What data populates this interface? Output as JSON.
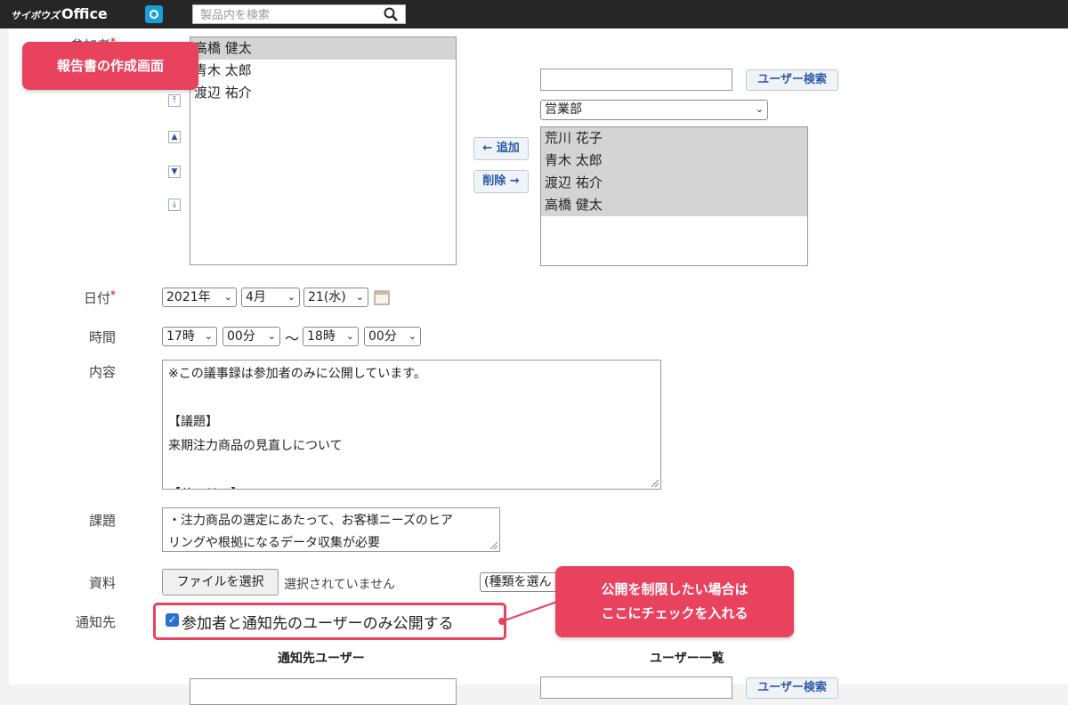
{
  "app": {
    "logo_small": "サイボウズ",
    "logo_big": "Office"
  },
  "search": {
    "placeholder": "製品内を検索"
  },
  "callouts": {
    "screen_title": "報告書の作成画面",
    "publish_line1": "公開を制限したい場合は",
    "publish_line2": "ここにチェックを入れる"
  },
  "participants": {
    "label": "参加者",
    "selected": [
      "高橋 健太",
      "青木 太郎",
      "渡辺 祐介"
    ],
    "add_label": "← 追加",
    "remove_label": "削除 →",
    "user_search_label": "ユーザー検索",
    "user_search_value": "",
    "group_select": "営業部",
    "candidates": [
      "荒川 花子",
      "青木 太郎",
      "渡辺 祐介",
      "高橋 健太"
    ]
  },
  "date": {
    "label": "日付",
    "year": "2021年",
    "month": "4月",
    "day": "21(水)"
  },
  "time": {
    "label": "時間",
    "start_hour": "17時",
    "start_min": "00分",
    "separator": "〜",
    "end_hour": "18時",
    "end_min": "00分"
  },
  "content": {
    "label": "内容",
    "lines": [
      "※この議事録は参加者のみに公開しています。",
      "",
      "【議題】",
      "来期注力商品の見直しについて",
      "",
      "【サマリー】"
    ]
  },
  "issues": {
    "label": "課題",
    "lines": [
      "・注力商品の選定にあたって、お客様ニーズのヒア",
      "リングや根拠になるデータ収集が必要"
    ]
  },
  "attachments": {
    "label": "資料",
    "file_button": "ファイルを選択",
    "no_file": "選択されていません",
    "type_select": "(種類を選ん"
  },
  "notify": {
    "label": "通知先",
    "checkbox_label": "参加者と通知先のユーザーのみ公開する",
    "checked": true,
    "col_notify_users": "通知先ユーザー",
    "col_user_list": "ユーザー一覧",
    "user_search_label": "ユーザー検索"
  },
  "colors": {
    "accent": "#e8425f",
    "topbar": "#262626",
    "link": "#2a5aa8"
  }
}
